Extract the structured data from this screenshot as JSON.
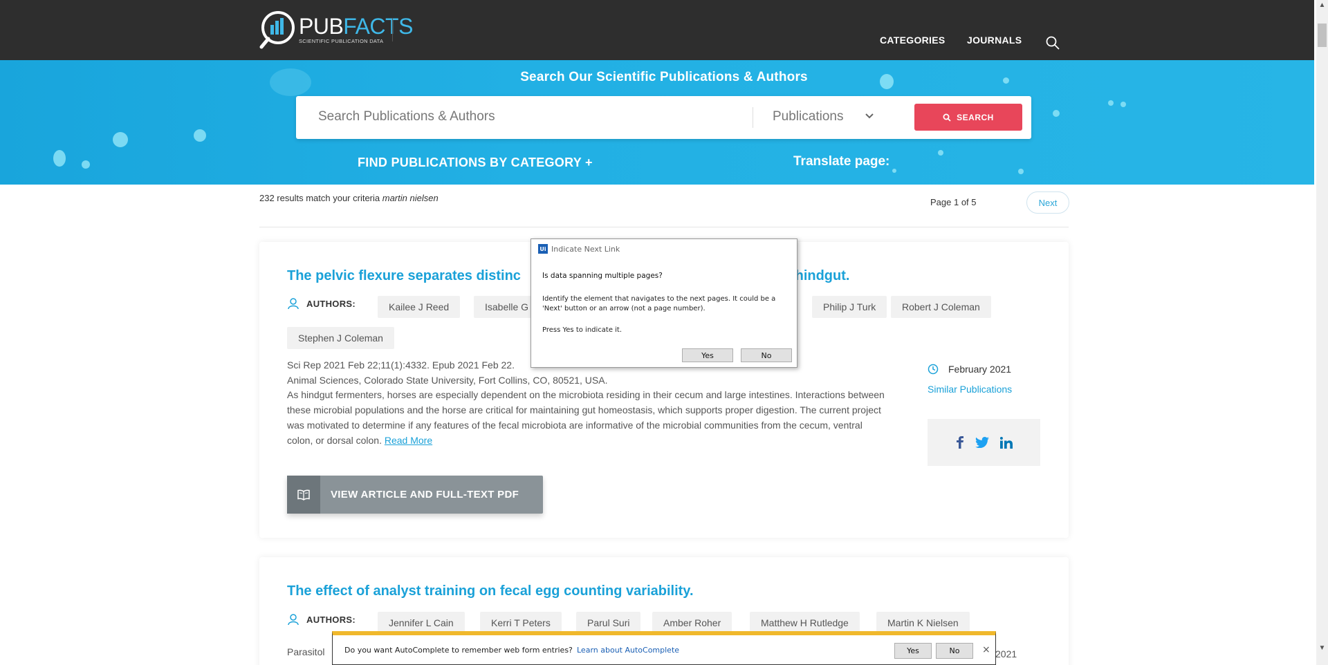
{
  "header": {
    "logo_main_a": "PUB",
    "logo_main_b": "FACTS",
    "logo_sub": "SCIENTIFIC PUBLICATION DATA",
    "nav": [
      "CATEGORIES",
      "JOURNALS"
    ]
  },
  "hero": {
    "title": "Search Our Scientific Publications & Authors",
    "search_placeholder": "Search Publications & Authors",
    "search_type": "Publications",
    "search_button": "SEARCH",
    "find_category": "FIND PUBLICATIONS BY CATEGORY +",
    "translate": "Translate page:"
  },
  "results": {
    "count_text": "232 results match your criteria",
    "query": "martin nielsen",
    "page_info": "Page 1 of 5",
    "next_label": "Next"
  },
  "articles": [
    {
      "title_left": "The pelvic flexure separates distinc",
      "title_right": "e hindgut.",
      "authors_label": "AUTHORS:",
      "authors": [
        "Kailee J Reed",
        "Isabelle G",
        "Philip J Turk",
        "Robert J Coleman",
        "Stephen J Coleman"
      ],
      "citation": "Sci Rep 2021 Feb 22;11(1):4332. Epub 2021 Feb 22.",
      "affiliation": "Animal Sciences, Colorado State University, Fort Collins, CO, 80521, USA.",
      "abstract": "As hindgut fermenters, horses are especially dependent on the microbiota residing in their cecum and large intestines. Interactions between these microbial populations and the horse are critical for maintaining gut homeostasis, which supports proper digestion. The current project was motivated to determine if any features of the fecal microbiota are informative of the microbial communities from the cecum, ventral colon, or dorsal colon.",
      "read_more": "Read More",
      "date": "February 2021",
      "similar": "Similar Publications",
      "view_button": "VIEW ARTICLE AND FULL-TEXT PDF"
    },
    {
      "title": "The effect of analyst training on fecal egg counting variability.",
      "authors_label": "AUTHORS:",
      "authors": [
        "Jennifer L Cain",
        "Kerri T Peters",
        "Parul Suri",
        "Amber Roher",
        "Matthew H Rutledge",
        "Martin K Nielsen"
      ],
      "citation_partial": "Parasitol",
      "date_partial": "2021"
    }
  ],
  "dialog": {
    "badge": "Ui",
    "title": "Indicate Next Link",
    "heading": "Is data spanning multiple pages?",
    "body": "Identify the element that navigates to the next pages. It could be a 'Next' button or an arrow (not a page number).",
    "press": "Press Yes to indicate it.",
    "yes": "Yes",
    "no": "No"
  },
  "autocomplete": {
    "text": "Do you want AutoComplete to remember web form entries?",
    "link": "Learn about AutoComplete",
    "yes": "Yes",
    "no": "No",
    "close": "×"
  },
  "colors": {
    "topbar": "#2e2e2e",
    "hero": "#22b0e4",
    "accent": "#1aa1d8",
    "search_button": "#e8465a",
    "autocomplete_border": "#f0b82c"
  }
}
